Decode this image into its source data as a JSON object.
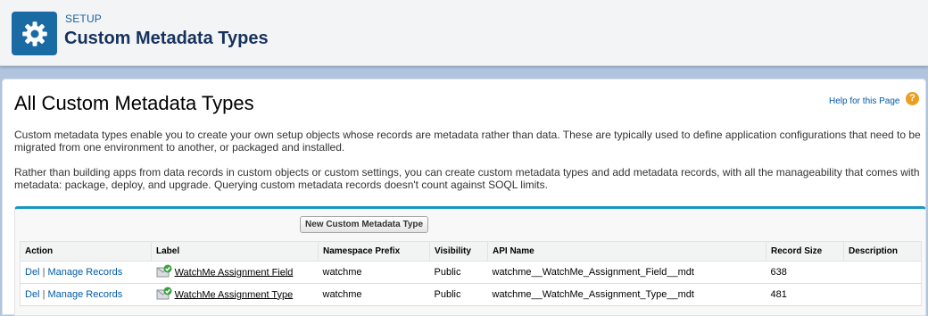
{
  "header": {
    "eyebrow": "SETUP",
    "title": "Custom Metadata Types",
    "icon": "gear-icon"
  },
  "main": {
    "title": "All Custom Metadata Types",
    "help_link": "Help for this Page",
    "help_icon_glyph": "?",
    "paragraphs": [
      "Custom metadata types enable you to create your own setup objects whose records are metadata rather than data. These are typically used to define application configurations that need to be migrated from one environment to another, or packaged and installed.",
      "Rather than building apps from data records in custom objects or custom settings, you can create custom metadata types and add metadata records, with all the manageability that comes with metadata: package, deploy, and upgrade. Querying custom metadata records doesn't count against SOQL limits."
    ],
    "new_button": "New Custom Metadata Type"
  },
  "table": {
    "headers": {
      "action": "Action",
      "label": "Label",
      "namespace": "Namespace Prefix",
      "visibility": "Visibility",
      "api_name": "API Name",
      "record_size": "Record Size",
      "description": "Description"
    },
    "rows": [
      {
        "del": "Del",
        "sep": "|",
        "manage": "Manage Records",
        "label": "WatchMe Assignment Field",
        "namespace": "watchme",
        "visibility": "Public",
        "api_name": "watchme__WatchMe_Assignment_Field__mdt",
        "record_size": "638",
        "description": ""
      },
      {
        "del": "Del",
        "sep": "|",
        "manage": "Manage Records",
        "label": "WatchMe Assignment Type",
        "namespace": "watchme",
        "visibility": "Public",
        "api_name": "watchme__WatchMe_Assignment_Type__mdt",
        "record_size": "481",
        "description": ""
      }
    ]
  },
  "colors": {
    "header_icon_bg": "#1a6aa3",
    "link": "#015ba7",
    "accent_border": "#1797c0",
    "page_bg": "#b0c4df"
  }
}
